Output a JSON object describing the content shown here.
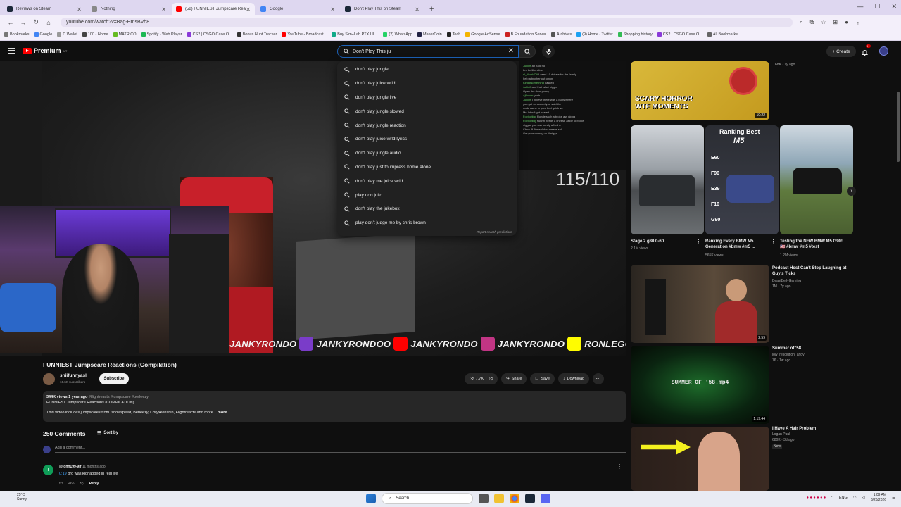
{
  "browser": {
    "tabs": [
      {
        "label": "Reviews on Steam",
        "color": "#1b2838"
      },
      {
        "label": "Nothing",
        "color": "#888888"
      },
      {
        "label": "(58) FUNNIEST Jumpscare Rea",
        "color": "#ff0000"
      },
      {
        "label": "Google",
        "color": "#4285f4"
      },
      {
        "label": "Don't Play This on Steam",
        "color": "#1b2838"
      }
    ],
    "url": "youtube.com/watch?v=Bag-HmsBVh8",
    "bookmarks": [
      "Bookmarks",
      "Google",
      "D.Wallet",
      "100 - Home",
      "MATRICO",
      "Spotify - Web Player",
      "CS2 | CSGO Case O...",
      "Bonus Hunt Tracker",
      "YouTube - Broadcast...",
      "Buy Sim+Lab PTX UL...",
      "(2) WhatsApp",
      "MakerCoin",
      "Tech",
      "Google AdSense",
      "B Foundation Server",
      "Archives",
      "(9) Home / Twitter",
      "Shopping history",
      "CS2 | CSGO Case O...",
      "All Bookmarks"
    ]
  },
  "youtube": {
    "logo": "Premium",
    "logo_region": "MT",
    "search_value": "Don't Play This ju",
    "create_label": "Create",
    "notif_count": "9+"
  },
  "suggestions": [
    "don't play jungle",
    "don't play juice wrld",
    "don't play jungle live",
    "don't play jungle slowed",
    "don't play jungle reaction",
    "don't play juice wrld lyrics",
    "don't play jungle audio",
    "don't play just to impress home alone",
    "don't play me juice wrld",
    "play don julio",
    "don't play the jukebox",
    "play don't judge me by chris brown"
  ],
  "suggest_report": "Report search predictions",
  "video": {
    "score": "115/110",
    "socials": [
      "JANKYRONDO",
      "JANKYRONDOO",
      "JANKYRONDO",
      "JANKYRONDO",
      "RONLEGGIN"
    ],
    "social_colors": [
      "#7a3cc9",
      "#ff0000",
      "#c13584",
      "#fffc00"
    ],
    "chat": [
      {
        "user": "JuDuff",
        "msg": "ah fuck no"
      },
      {
        "user": "",
        "msg": "bro be like citrus"
      },
      {
        "user": "el_NioshOA",
        "msg": "I need 10 dollars for the family"
      },
      {
        "user": "",
        "msg": "help a brother out cmon"
      },
      {
        "user": "Kindofsomething",
        "msg": "I asked"
      },
      {
        "user": "JuDuff",
        "msg": "and that what nigga"
      },
      {
        "user": "",
        "msg": "Open the door pussy"
      },
      {
        "user": "Ajlboom",
        "msg": "yeah"
      },
      {
        "user": "JuDuff",
        "msg": "I believe there was a guns where"
      },
      {
        "user": "",
        "msg": "you get so scared you said the"
      },
      {
        "user": "",
        "msg": "dude came in your bed quick so"
      },
      {
        "user": "",
        "msg": "Mr. I don't get scared"
      },
      {
        "user": "Foxtrotting",
        "msg": "Ronde such a broke ass nigga"
      },
      {
        "user": "Foxtrotting",
        "msg": "suhhh needs a cheese aside to broke"
      },
      {
        "user": "",
        "msg": "niggas you can barely afford a"
      },
      {
        "user": "",
        "msg": "Chick-fil-A meal don means sol"
      },
      {
        "user": "",
        "msg": "Get your money up lil nigga"
      }
    ]
  },
  "watch": {
    "title": "FUNNIEST Jumpscare Reactions (Compilation)",
    "channel": "shiifunnyasl",
    "subscribers": "16.6K subscribers",
    "subscribe_label": "Subscribe",
    "likes": "7.7K",
    "share_label": "Share",
    "save_label": "Save",
    "download_label": "Download",
    "desc_meta": "344K views  1 year ago",
    "desc_tags": "#flightreacts #jumpscare #berleezy",
    "desc_line1": "FUNNIEST Jumpscare Reactions (COMPILATION)",
    "desc_line2": "Thid video includes jumpscares from Ishowspeed, Berleezy, Coryxkenshin, Flightreacts and more",
    "desc_more": "...more",
    "comments_count": "250 Comments",
    "sort_label": "Sort by",
    "add_comment": "Add a comment...",
    "comment": {
      "avatar": "T",
      "user": "@john199-9lr",
      "time": "11 months ago",
      "timestamp": "0:19",
      "text": "bro was kidnapped in real life",
      "likes": "465",
      "reply": "Reply"
    }
  },
  "sidebar": {
    "top": {
      "title": "",
      "views": "68K",
      "age": "1y ago",
      "duration": "10:22",
      "thumb_text": "SCARY HORROR WTF MOMENTS"
    },
    "shorts": [
      {
        "title": "Stage 2 g80 0-60",
        "views": "2.1M views"
      },
      {
        "title": "Ranking Every BMW M5 Generation #bmw #m5 ...",
        "views": "565K views",
        "thumb_text": "Ranking Best",
        "gens": [
          "E60",
          "F90",
          "E39",
          "F10",
          "G90"
        ]
      },
      {
        "title": "Testing the NEW BMW M5 G90! 🇺🇸 #bmw #m5 #test",
        "views": "1.2M views"
      }
    ],
    "videos": [
      {
        "title": "Podcast Host Can't Stop Laughing at Guy's Ticks",
        "channel": "BeastBellyGaming",
        "meta": "1M · 7y ago",
        "duration": "2:59"
      },
      {
        "title": "Summer of '58",
        "channel": "low_resolution_andy",
        "meta": "76 · 1w ago",
        "duration": "1:19:44",
        "thumb_text": "SUMMER OF '58.mp4"
      },
      {
        "title": "I Have A Hair Problem",
        "channel": "Logan Paul",
        "meta": "680K · 3d ago",
        "badge": "New"
      }
    ]
  },
  "taskbar": {
    "temp": "25°C",
    "weather": "Sunny",
    "search": "Search",
    "lang": "ENG",
    "time": "1:09 AM",
    "date": "8/20/2026"
  }
}
